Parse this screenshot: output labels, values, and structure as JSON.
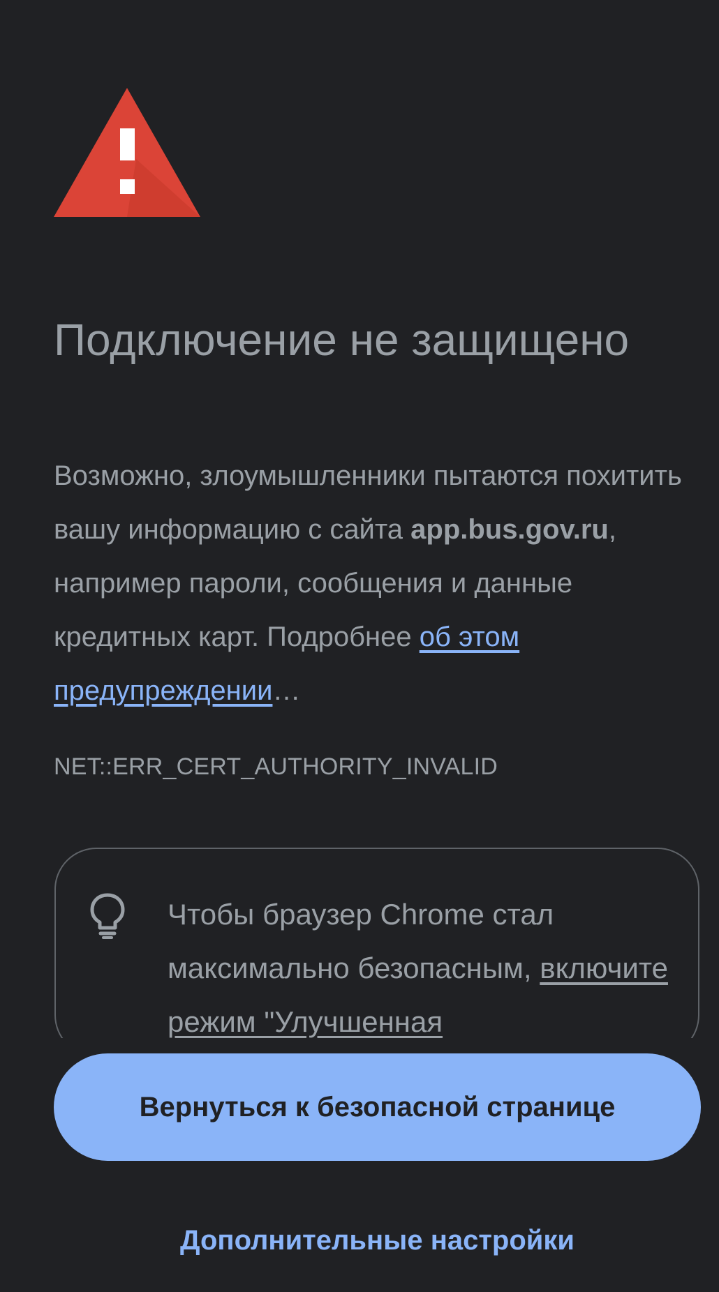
{
  "colors": {
    "background": "#202124",
    "text": "#9aa0a6",
    "accent": "#8ab4f8",
    "warning_red": "#db4437",
    "card_border": "#5f6368"
  },
  "icons": {
    "warning": "warning-triangle-icon",
    "tip": "lightbulb-icon"
  },
  "page": {
    "title": "Подключение не защищено",
    "description": {
      "part1": "Возможно, злоумышленники пытаются похитить вашу информацию с сайта ",
      "domain": "app.bus.gov.ru",
      "part2": ", например пароли, сообщения и данные кредитных карт. Подробнее ",
      "link": "об этом предупреждении",
      "ellipsis": "…"
    },
    "error_code": "NET::ERR_CERT_AUTHORITY_INVALID",
    "tip": {
      "text": "Чтобы браузер Chrome стал максимально безопасным, ",
      "link": "включите режим \"Улучшенная"
    },
    "primary_button": "Вернуться к безопасной странице",
    "secondary_button": "Дополнительные настройки"
  }
}
